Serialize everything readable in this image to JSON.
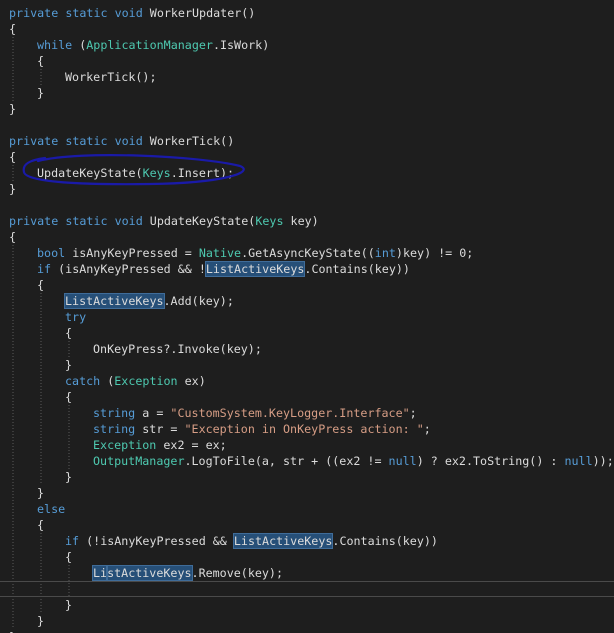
{
  "editor": {
    "theme": {
      "background": "#1e1e1e",
      "text": "#dcdcdc",
      "keyword": "#569cd6",
      "type": "#4ec9b0",
      "string": "#d69d85",
      "highlight": "#264f78",
      "annotation": "#1a1aa8"
    },
    "cursor_line": 36,
    "lines": [
      {
        "indent": 0,
        "tokens": [
          {
            "t": "private",
            "c": "kw"
          },
          {
            "t": " "
          },
          {
            "t": "static",
            "c": "kw"
          },
          {
            "t": " "
          },
          {
            "t": "void",
            "c": "kw"
          },
          {
            "t": " WorkerUpdater()"
          }
        ]
      },
      {
        "indent": 0,
        "tokens": [
          {
            "t": "{"
          }
        ]
      },
      {
        "indent": 1,
        "tokens": [
          {
            "t": "while",
            "c": "kw"
          },
          {
            "t": " ("
          },
          {
            "t": "ApplicationManager",
            "c": "ty"
          },
          {
            "t": ".IsWork)"
          }
        ]
      },
      {
        "indent": 1,
        "tokens": [
          {
            "t": "{"
          }
        ]
      },
      {
        "indent": 2,
        "tokens": [
          {
            "t": "WorkerTick();"
          }
        ]
      },
      {
        "indent": 1,
        "tokens": [
          {
            "t": "}"
          }
        ]
      },
      {
        "indent": 0,
        "tokens": [
          {
            "t": "}"
          }
        ]
      },
      {
        "indent": 0,
        "tokens": []
      },
      {
        "indent": 0,
        "tokens": [
          {
            "t": "private",
            "c": "kw"
          },
          {
            "t": " "
          },
          {
            "t": "static",
            "c": "kw"
          },
          {
            "t": " "
          },
          {
            "t": "void",
            "c": "kw"
          },
          {
            "t": " WorkerTick()"
          }
        ]
      },
      {
        "indent": 0,
        "tokens": [
          {
            "t": "{"
          }
        ]
      },
      {
        "indent": 1,
        "tokens": [
          {
            "t": "UpdateKeyState("
          },
          {
            "t": "Keys",
            "c": "ty"
          },
          {
            "t": ".Insert);"
          }
        ]
      },
      {
        "indent": 0,
        "tokens": [
          {
            "t": "}"
          }
        ]
      },
      {
        "indent": 0,
        "tokens": []
      },
      {
        "indent": 0,
        "tokens": [
          {
            "t": "private",
            "c": "kw"
          },
          {
            "t": " "
          },
          {
            "t": "static",
            "c": "kw"
          },
          {
            "t": " "
          },
          {
            "t": "void",
            "c": "kw"
          },
          {
            "t": " UpdateKeyState("
          },
          {
            "t": "Keys",
            "c": "ty"
          },
          {
            "t": " key)"
          }
        ]
      },
      {
        "indent": 0,
        "tokens": [
          {
            "t": "{"
          }
        ]
      },
      {
        "indent": 1,
        "tokens": [
          {
            "t": "bool",
            "c": "kw"
          },
          {
            "t": " isAnyKeyPressed = "
          },
          {
            "t": "Native",
            "c": "ty"
          },
          {
            "t": ".GetAsyncKeyState(("
          },
          {
            "t": "int",
            "c": "kw"
          },
          {
            "t": ")key) != 0;"
          }
        ]
      },
      {
        "indent": 1,
        "tokens": [
          {
            "t": "if",
            "c": "kw"
          },
          {
            "t": " (isAnyKeyPressed && !"
          },
          {
            "t": "ListActiveKeys",
            "h": 1
          },
          {
            "t": ".Contains(key))"
          }
        ]
      },
      {
        "indent": 1,
        "tokens": [
          {
            "t": "{"
          }
        ]
      },
      {
        "indent": 2,
        "tokens": [
          {
            "t": "ListActiveKeys",
            "h": 1
          },
          {
            "t": ".Add(key);"
          }
        ]
      },
      {
        "indent": 2,
        "tokens": [
          {
            "t": "try",
            "c": "kw"
          }
        ]
      },
      {
        "indent": 2,
        "tokens": [
          {
            "t": "{"
          }
        ]
      },
      {
        "indent": 3,
        "tokens": [
          {
            "t": "OnKeyPress?.Invoke(key);"
          }
        ]
      },
      {
        "indent": 2,
        "tokens": [
          {
            "t": "}"
          }
        ]
      },
      {
        "indent": 2,
        "tokens": [
          {
            "t": "catch",
            "c": "kw"
          },
          {
            "t": " ("
          },
          {
            "t": "Exception",
            "c": "ty"
          },
          {
            "t": " ex)"
          }
        ]
      },
      {
        "indent": 2,
        "tokens": [
          {
            "t": "{"
          }
        ]
      },
      {
        "indent": 3,
        "tokens": [
          {
            "t": "string",
            "c": "kw"
          },
          {
            "t": " a = "
          },
          {
            "t": "\"CustomSystem.KeyLogger.Interface\"",
            "c": "str"
          },
          {
            "t": ";"
          }
        ]
      },
      {
        "indent": 3,
        "tokens": [
          {
            "t": "string",
            "c": "kw"
          },
          {
            "t": " str = "
          },
          {
            "t": "\"Exception in OnKeyPress action: \"",
            "c": "str"
          },
          {
            "t": ";"
          }
        ]
      },
      {
        "indent": 3,
        "tokens": [
          {
            "t": "Exception",
            "c": "ty"
          },
          {
            "t": " ex2 = ex;"
          }
        ]
      },
      {
        "indent": 3,
        "tokens": [
          {
            "t": "OutputManager",
            "c": "ty"
          },
          {
            "t": ".LogToFile(a, str + ((ex2 != "
          },
          {
            "t": "null",
            "c": "kw"
          },
          {
            "t": ") ? ex2.ToString() : "
          },
          {
            "t": "null",
            "c": "kw"
          },
          {
            "t": "));"
          }
        ]
      },
      {
        "indent": 2,
        "tokens": [
          {
            "t": "}"
          }
        ]
      },
      {
        "indent": 1,
        "tokens": [
          {
            "t": "}"
          }
        ]
      },
      {
        "indent": 1,
        "tokens": [
          {
            "t": "else",
            "c": "kw"
          }
        ]
      },
      {
        "indent": 1,
        "tokens": [
          {
            "t": "{"
          }
        ]
      },
      {
        "indent": 2,
        "tokens": [
          {
            "t": "if",
            "c": "kw"
          },
          {
            "t": " (!isAnyKeyPressed && "
          },
          {
            "t": "ListActiveKeys",
            "h": 1
          },
          {
            "t": ".Contains(key))"
          }
        ]
      },
      {
        "indent": 2,
        "tokens": [
          {
            "t": "{"
          }
        ]
      },
      {
        "indent": 3,
        "tokens": [
          {
            "t": "Li",
            "h": 1
          },
          {
            "caret": 1
          },
          {
            "t": "stActiveKeys",
            "h": 1
          },
          {
            "t": ".Remove(key);"
          }
        ]
      },
      {
        "indent": 3,
        "tokens": []
      },
      {
        "indent": 2,
        "tokens": [
          {
            "t": "}"
          }
        ]
      },
      {
        "indent": 1,
        "tokens": [
          {
            "t": "}"
          }
        ]
      },
      {
        "indent": 0,
        "tokens": [
          {
            "t": "}"
          }
        ]
      }
    ]
  }
}
